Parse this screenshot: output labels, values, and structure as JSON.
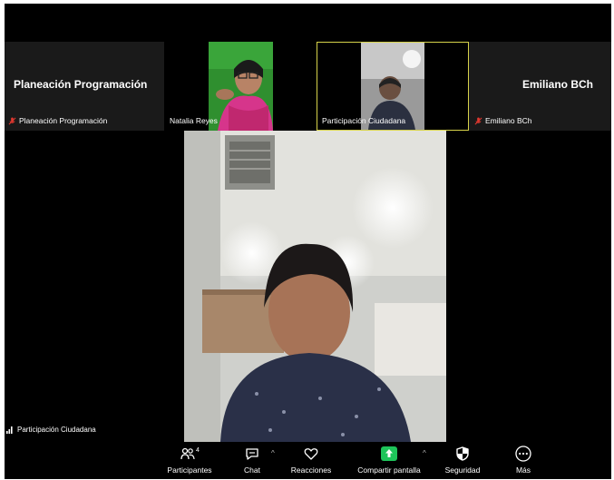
{
  "participants_strip": {
    "tile1": {
      "big_name": "Planeación Programación",
      "label": "Planeación Programación"
    },
    "tile2": {
      "label": "Natalia Reyes"
    },
    "tile3": {
      "label": "Participación Ciudadana"
    },
    "tile4": {
      "big_name": "Emiliano BCh",
      "label": "Emiliano BCh"
    }
  },
  "main": {
    "speaker_label": "Participación Ciudadana"
  },
  "toolbar": {
    "participants_label": "Participantes",
    "participants_count": "4",
    "chat_label": "Chat",
    "reactions_label": "Reacciones",
    "share_label": "Compartir pantalla",
    "security_label": "Seguridad",
    "more_label": "Más"
  },
  "colors": {
    "share_green": "#1ec45a",
    "mute_red": "#e0382f",
    "active_border": "#d6d24a"
  }
}
